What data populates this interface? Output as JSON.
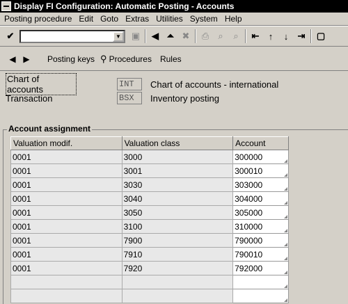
{
  "window": {
    "title": "Display FI Configuration: Automatic Posting - Accounts"
  },
  "menu": [
    "Posting procedure",
    "Edit",
    "Goto",
    "Extras",
    "Utilities",
    "System",
    "Help"
  ],
  "toolbar": {
    "command_value": ""
  },
  "app_toolbar": {
    "posting_keys": "Posting keys",
    "procedures": "Procedures",
    "rules": "Rules"
  },
  "fields": {
    "chart_label": "Chart of accounts",
    "chart_value": "INT",
    "chart_desc": "Chart of accounts - international",
    "trans_label": "Transaction",
    "trans_value": "BSX",
    "trans_desc": "Inventory posting"
  },
  "group": {
    "title": "Account assignment"
  },
  "table": {
    "headers": [
      "Valuation modif.",
      "Valuation class",
      "Account"
    ],
    "rows": [
      [
        "0001",
        "3000",
        "300000"
      ],
      [
        "0001",
        "3001",
        "300010"
      ],
      [
        "0001",
        "3030",
        "303000"
      ],
      [
        "0001",
        "3040",
        "304000"
      ],
      [
        "0001",
        "3050",
        "305000"
      ],
      [
        "0001",
        "3100",
        "310000"
      ],
      [
        "0001",
        "7900",
        "790000"
      ],
      [
        "0001",
        "7910",
        "790010"
      ],
      [
        "0001",
        "7920",
        "792000"
      ],
      [
        "",
        "",
        ""
      ],
      [
        "",
        "",
        ""
      ]
    ]
  }
}
